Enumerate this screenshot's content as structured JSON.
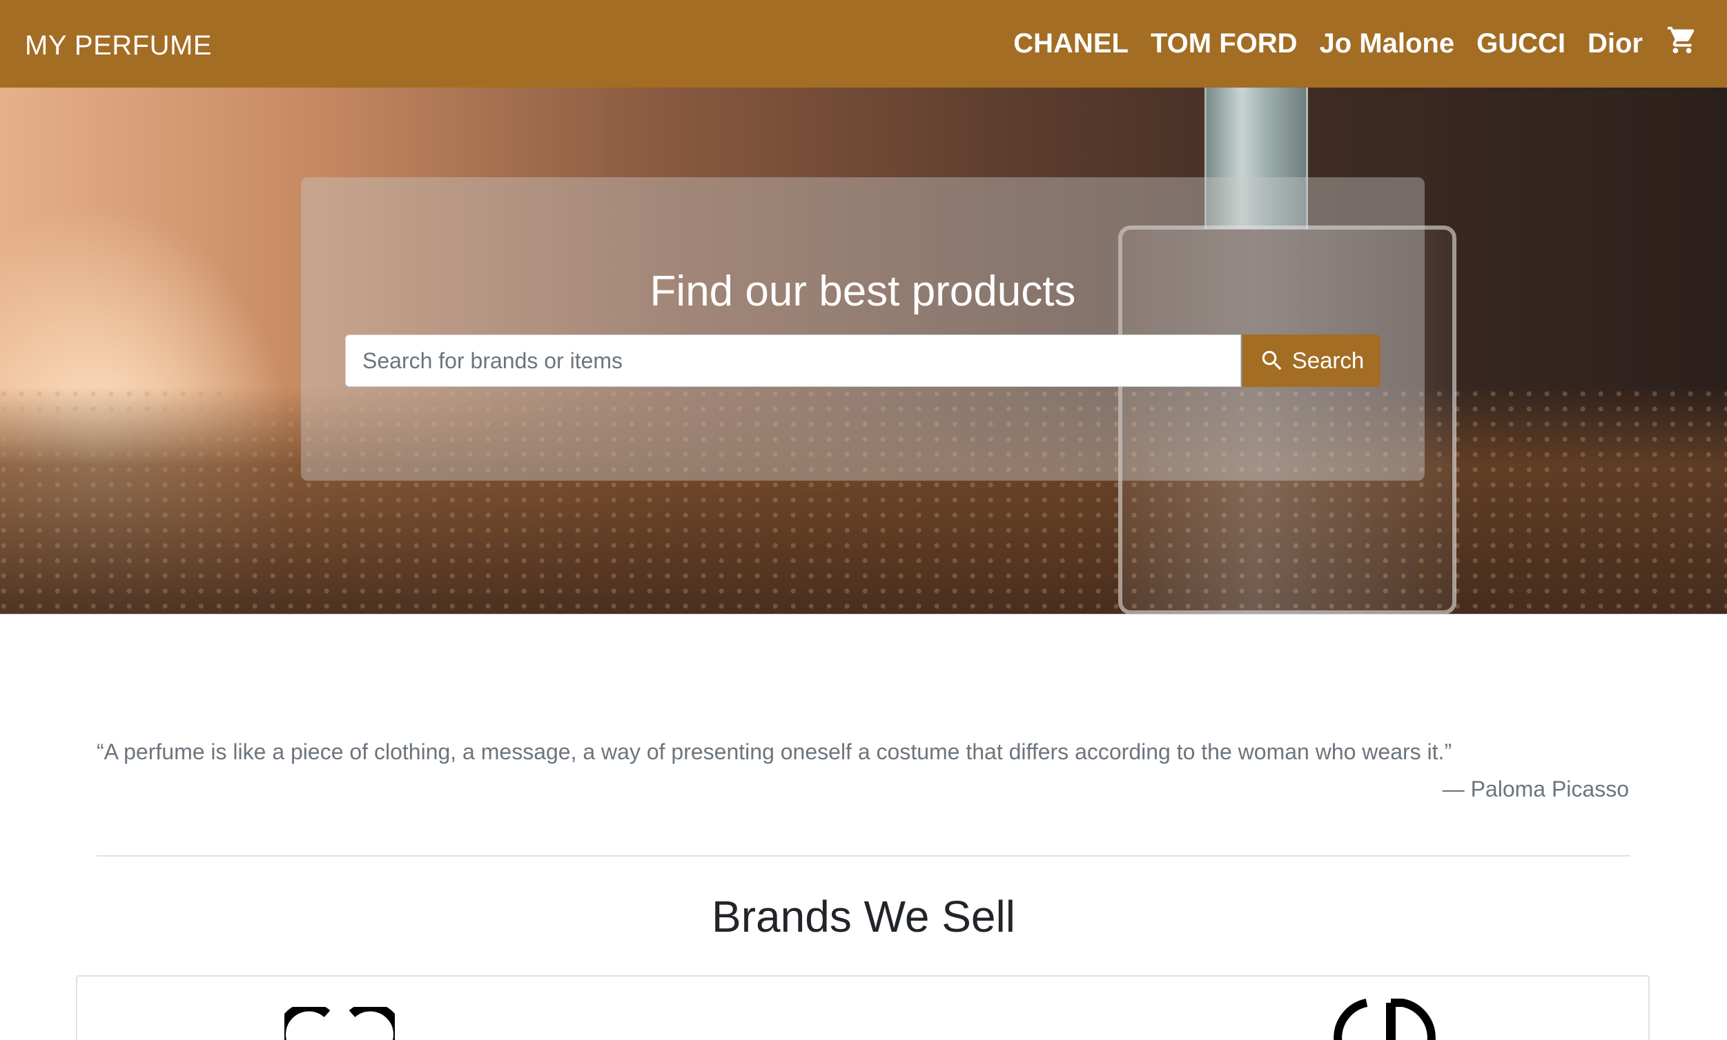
{
  "navbar": {
    "brand": "MY PERFUME",
    "links": [
      "CHANEL",
      "TOM FORD",
      "Jo Malone",
      "GUCCI",
      "Dior"
    ],
    "cart_icon": "shopping-cart-icon",
    "background_color": "#a36d24"
  },
  "hero": {
    "title": "Find our best products",
    "search": {
      "placeholder": "Search for brands or items",
      "value": "",
      "button_label": "Search",
      "button_icon": "search-icon"
    }
  },
  "quote": {
    "text": "“A perfume is like a piece of clothing, a message, a way of presenting oneself a costume that differs according to the woman who wears it.”",
    "author": "— Paloma Picasso"
  },
  "brands": {
    "heading": "Brands We Sell",
    "logos": [
      "chanel-logo",
      "dior-logo"
    ]
  }
}
